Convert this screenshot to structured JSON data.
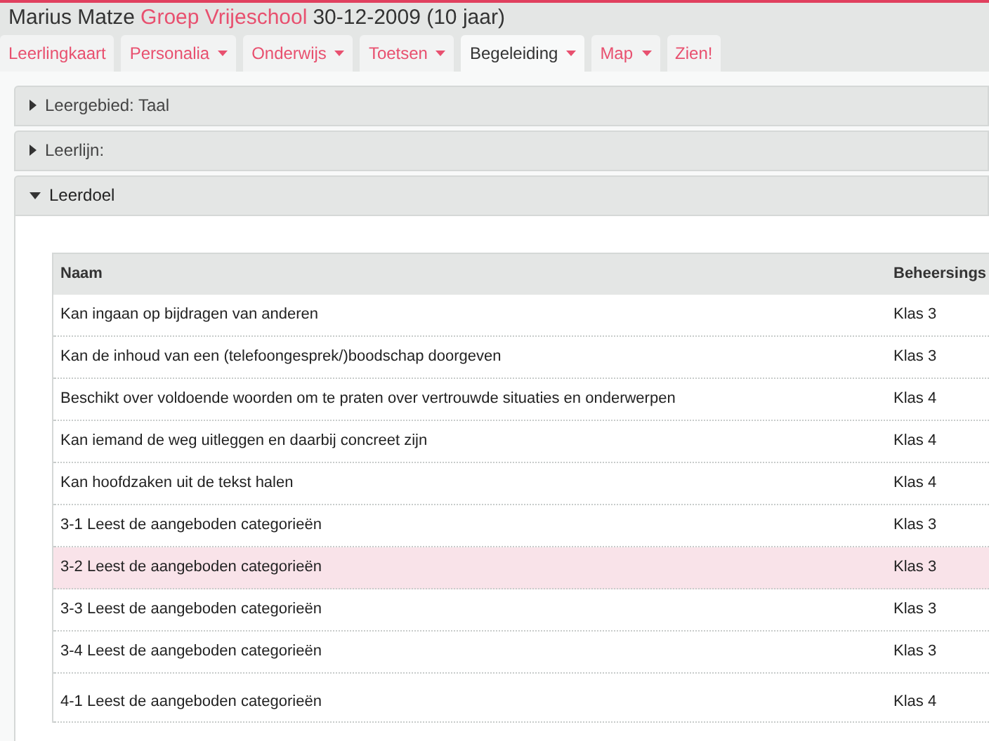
{
  "header": {
    "name": "Marius Matze",
    "group": "Groep Vrijeschool",
    "birth": "30-12-2009 (10 jaar)"
  },
  "tabs": [
    {
      "label": "Leerlingkaart",
      "dropdown": false,
      "selected": false
    },
    {
      "label": "Personalia",
      "dropdown": true,
      "selected": false
    },
    {
      "label": "Onderwijs",
      "dropdown": true,
      "selected": false
    },
    {
      "label": "Toetsen",
      "dropdown": true,
      "selected": false
    },
    {
      "label": "Begeleiding",
      "dropdown": true,
      "selected": true
    },
    {
      "label": "Map",
      "dropdown": true,
      "selected": false
    },
    {
      "label": "Zien!",
      "dropdown": false,
      "selected": false
    }
  ],
  "panels": [
    {
      "title": "Leergebied: Taal",
      "expanded": false
    },
    {
      "title": "Leerlijn:",
      "expanded": false
    },
    {
      "title": "Leerdoel",
      "expanded": true
    }
  ],
  "table": {
    "columns": [
      "Naam",
      "Beheersings"
    ],
    "rows": [
      {
        "name": "Kan ingaan op bijdragen van anderen",
        "level": "Klas 3",
        "selected": false
      },
      {
        "name": "Kan de inhoud van een (telefoongesprek/)boodschap doorgeven",
        "level": "Klas 3",
        "selected": false
      },
      {
        "name": "Beschikt over voldoende woorden om te praten over vertrouwde situaties en onderwerpen",
        "level": "Klas 4",
        "selected": false
      },
      {
        "name": "Kan iemand de weg uitleggen en daarbij concreet zijn",
        "level": "Klas 4",
        "selected": false
      },
      {
        "name": "Kan hoofdzaken uit de tekst halen",
        "level": "Klas 4",
        "selected": false
      },
      {
        "name": "3-1 Leest de aangeboden categorieën",
        "level": "Klas 3",
        "selected": false
      },
      {
        "name": "3-2 Leest de aangeboden categorieën",
        "level": "Klas 3",
        "selected": true
      },
      {
        "name": "3-3 Leest de aangeboden categorieën",
        "level": "Klas 3",
        "selected": false
      },
      {
        "name": "3-4 Leest de aangeboden categorieën",
        "level": "Klas 3",
        "selected": false
      },
      {
        "name": "4-1 Leest de aangeboden categorieën",
        "level": "Klas 4",
        "selected": false
      }
    ]
  }
}
